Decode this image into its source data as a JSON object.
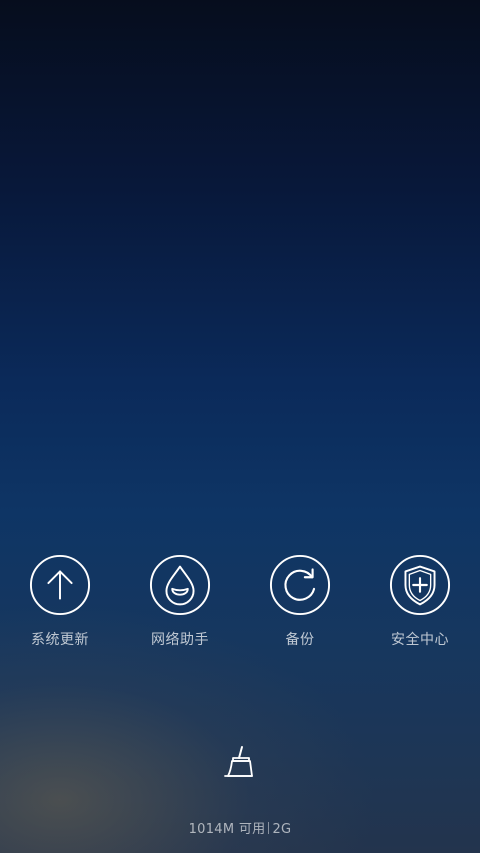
{
  "shortcuts": [
    {
      "label": "系统更新",
      "icon": "arrow-up-icon"
    },
    {
      "label": "网络助手",
      "icon": "water-drop-icon"
    },
    {
      "label": "备份",
      "icon": "backup-icon"
    },
    {
      "label": "安全中心",
      "icon": "shield-plus-icon"
    }
  ],
  "cleaner": {
    "icon": "broom-icon"
  },
  "memory": {
    "available": "1014M 可用",
    "total": "2G"
  },
  "colors": {
    "icon_stroke": "#ffffff",
    "label_text": "#b8bdc6"
  }
}
